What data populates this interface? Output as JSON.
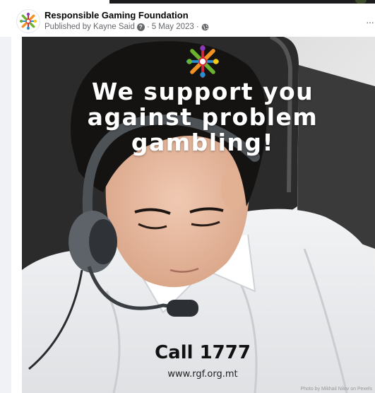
{
  "post": {
    "page_name": "Responsible Gaming Foundation",
    "published_by": "Published by Kayne Said",
    "date": "5 May 2023",
    "separator": "·",
    "more_label": "···"
  },
  "image": {
    "headline_lines": [
      "We support you",
      "against problem",
      "gambling!"
    ],
    "call_to_action": "Call 1777",
    "website": "www.rgf.org.mt",
    "photo_credit": "Photo by Mikhail Nilov on Pexels"
  },
  "icons": {
    "avatar": "rgf-logo-icon",
    "info": "question-circle-icon",
    "audience": "globe-icon",
    "more": "more-dots-icon"
  },
  "colors": {
    "logo_green": "#6bb32e",
    "logo_orange": "#f29222",
    "logo_red": "#d7263d",
    "logo_blue": "#2a8fd0",
    "logo_purple": "#8a3ab9",
    "logo_yellow": "#f6c913"
  }
}
